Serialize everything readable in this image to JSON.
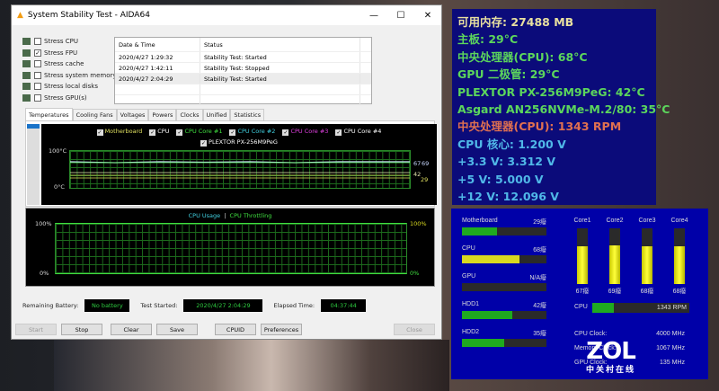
{
  "window": {
    "title": "System Stability Test - AIDA64",
    "minimize": "—",
    "maximize": "☐",
    "close": "✕"
  },
  "stress": [
    {
      "label": "Stress CPU",
      "checked": false
    },
    {
      "label": "Stress FPU",
      "checked": true
    },
    {
      "label": "Stress cache",
      "checked": false
    },
    {
      "label": "Stress system memory",
      "checked": false
    },
    {
      "label": "Stress local disks",
      "checked": false
    },
    {
      "label": "Stress GPU(s)",
      "checked": false
    }
  ],
  "log": {
    "headers": [
      "Date & Time",
      "Status"
    ],
    "rows": [
      [
        "2020/4/27 1:29:32",
        "Stability Test: Started"
      ],
      [
        "2020/4/27 1:42:11",
        "Stability Test: Stopped"
      ],
      [
        "2020/4/27 2:04:29",
        "Stability Test: Started"
      ]
    ]
  },
  "tabs": [
    "Temperatures",
    "Cooling Fans",
    "Voltages",
    "Powers",
    "Clocks",
    "Unified",
    "Statistics"
  ],
  "temp_chart": {
    "legend": [
      {
        "label": "Motherboard",
        "color": "#e0e060"
      },
      {
        "label": "CPU",
        "color": "#ffffff"
      },
      {
        "label": "CPU Core #1",
        "color": "#40e040"
      },
      {
        "label": "CPU Core #2",
        "color": "#40d0e0"
      },
      {
        "label": "CPU Core #3",
        "color": "#e040e0"
      },
      {
        "label": "CPU Core #4",
        "color": "#ffffff"
      },
      {
        "label": "PLEXTOR PX-256M9PeG",
        "color": "#ffffff"
      }
    ],
    "ymax": "100°C",
    "ymin": "0°C",
    "end_labels": [
      "67",
      "69",
      "42",
      "29"
    ]
  },
  "usage_chart": {
    "title1": "CPU Usage",
    "sep": "|",
    "title2": "CPU Throttling",
    "ymax": "100%",
    "ymin": "0%"
  },
  "status": {
    "battery_label": "Remaining Battery:",
    "battery": "No battery",
    "started_label": "Test Started:",
    "started": "2020/4/27 2:04:29",
    "elapsed_label": "Elapsed Time:",
    "elapsed": "04:37:44"
  },
  "buttons": {
    "start": "Start",
    "stop": "Stop",
    "clear": "Clear",
    "save": "Save",
    "cpuid": "CPUID",
    "preferences": "Preferences",
    "close": "Close"
  },
  "osd": [
    {
      "text": "可用内存: 27488 MB",
      "color": "#e8e0a0"
    },
    {
      "text": "主板: 29°C",
      "color": "#5cd65c"
    },
    {
      "text": "中央处理器(CPU): 68°C",
      "color": "#5cd65c"
    },
    {
      "text": "GPU 二极管: 29°C",
      "color": "#5cd65c"
    },
    {
      "text": "PLEXTOR PX-256M9PeG: 42°C",
      "color": "#5cd65c"
    },
    {
      "text": "Asgard AN256NVMe-M.2/80: 35°C",
      "color": "#5cd65c"
    },
    {
      "text": "中央处理器(CPU): 1343 RPM",
      "color": "#e07050"
    },
    {
      "text": "CPU 核心: 1.200 V",
      "color": "#50b8e8"
    },
    {
      "text": "+3.3 V: 3.312 V",
      "color": "#50b8e8"
    },
    {
      "text": "+5 V: 5.000 V",
      "color": "#50b8e8"
    },
    {
      "text": "+12 V: 12.096 V",
      "color": "#50b8e8"
    }
  ],
  "gadget": {
    "hbars": [
      {
        "label": "Motherboard",
        "value": "29癈",
        "fill": 0.42,
        "color": "#1faa1f"
      },
      {
        "label": "CPU",
        "value": "68癈",
        "fill": 0.68,
        "color": "#d8d820"
      },
      {
        "label": "GPU",
        "value": "N/A癈",
        "fill": 0,
        "color": "#1faa1f"
      },
      {
        "label": "HDD1",
        "value": "42癈",
        "fill": 0.6,
        "color": "#1faa1f"
      },
      {
        "label": "HDD2",
        "value": "35癈",
        "fill": 0.5,
        "color": "#1faa1f"
      }
    ],
    "cores": [
      {
        "label": "Core1",
        "value": "67癈",
        "fill": 0.67
      },
      {
        "label": "Core2",
        "value": "69癈",
        "fill": 0.69
      },
      {
        "label": "Core3",
        "value": "68癈",
        "fill": 0.68
      },
      {
        "label": "Core4",
        "value": "68癈",
        "fill": 0.68
      }
    ],
    "fan": {
      "label": "CPU",
      "value": "1343 RPM",
      "fill": 0.22
    },
    "clocks": [
      {
        "label": "CPU Clock:",
        "value": "4000 MHz"
      },
      {
        "label": "Memory Clock:",
        "value": "1067 MHz"
      },
      {
        "label": "GPU Clock:",
        "value": "135 MHz"
      }
    ]
  },
  "watermark": {
    "logo": "ZOL",
    "sub": "中关村在线"
  }
}
